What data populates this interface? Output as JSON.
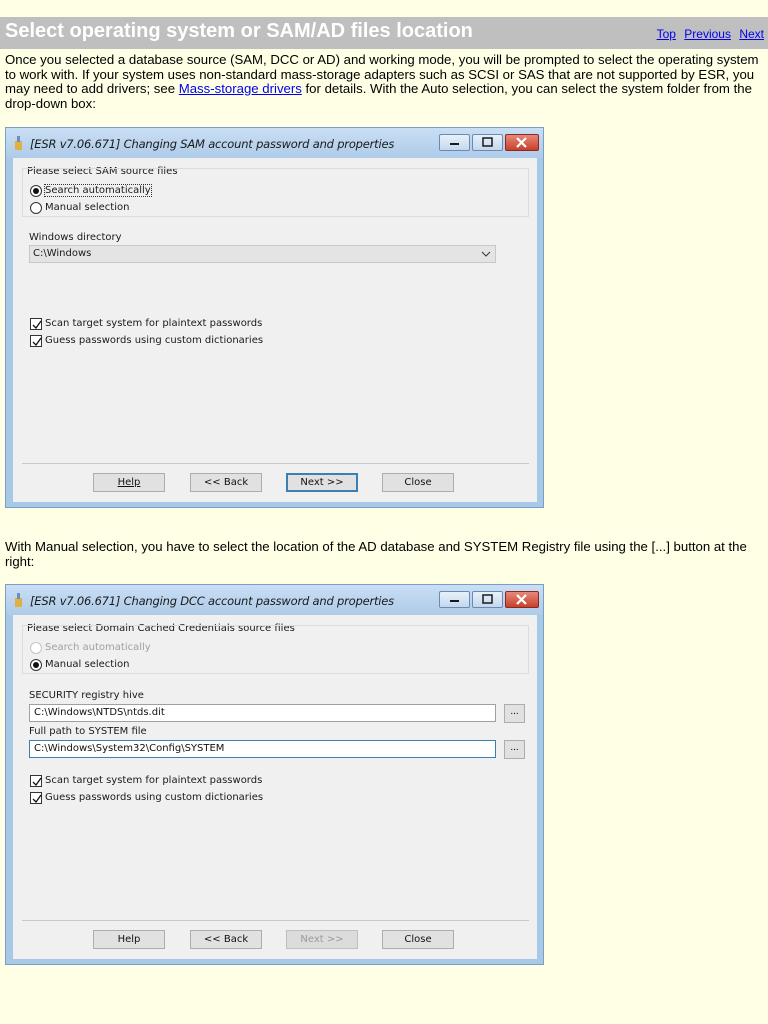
{
  "header": {
    "title": "Select operating system or SAM/AD files location",
    "nav": {
      "top": "Top",
      "previous": "Previous",
      "next": "Next"
    }
  },
  "intro": {
    "before_link": "Once you selected a database source (SAM, DCC or AD) and working mode, you will be prompted to select the operating system to work with. If your system uses non-standard mass-storage adapters such as SCSI or SAS that are not supported by ESR, you may need to add drivers; see ",
    "link": "Mass-storage drivers",
    "after_link": " for details. With the Auto selection, you can select the system folder from the drop-down box:"
  },
  "manual_text": "With Manual selection, you have to select the location of the AD database and SYSTEM Registry file using the [...] button at the right:",
  "dialog1": {
    "title": "[ESR v7.06.671]  Changing SAM account password and properties",
    "group_label": "Please select SAM source files",
    "radio_auto": "Search automatically",
    "radio_manual": "Manual selection",
    "dir_label": "Windows directory",
    "dir_value": "C:\\Windows",
    "check_scan": "Scan target system for plaintext passwords",
    "check_guess": "Guess passwords using custom dictionaries",
    "btn_help": "Help",
    "btn_back": "<< Back",
    "btn_next": "Next >>",
    "btn_close": "Close"
  },
  "dialog2": {
    "title": "[ESR v7.06.671]  Changing DCC account password and properties",
    "group_label": "Please select Domain Cached Credentials source files",
    "radio_auto": "Search automatically",
    "radio_manual": "Manual selection",
    "security_label": "SECURITY registry hive",
    "security_value": "C:\\Windows\\NTDS\\ntds.dit",
    "system_label": "Full path to SYSTEM file",
    "system_value": "C:\\Windows\\System32\\Config\\SYSTEM",
    "browse": "...",
    "check_scan": "Scan target system for plaintext passwords",
    "check_guess": "Guess passwords using custom dictionaries",
    "btn_help": "Help",
    "btn_back": "<< Back",
    "btn_next": "Next >>",
    "btn_close": "Close"
  }
}
